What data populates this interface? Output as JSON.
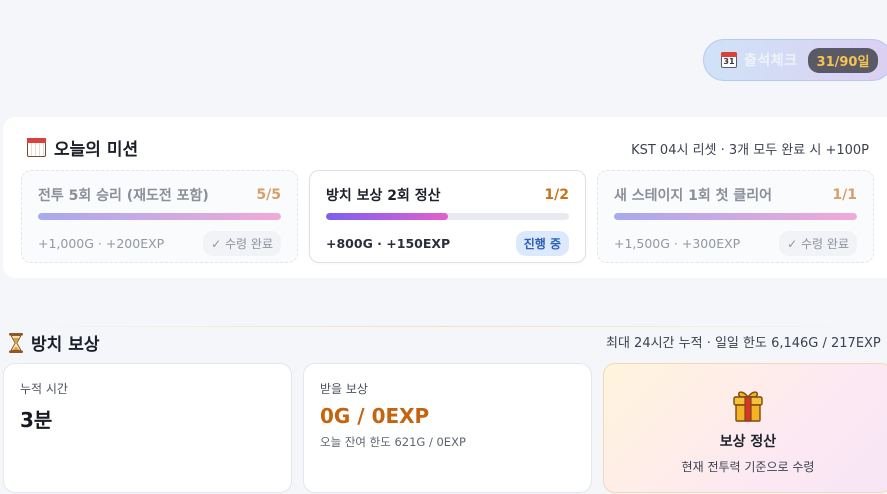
{
  "attendance": {
    "label": "출석체크",
    "count": "31/90일",
    "icon": "calendar-icon",
    "icon_text": "31"
  },
  "missions": {
    "title": "오늘의 미션",
    "meta": "KST 04시 리셋 · 3개 모두 완료 시 +100P",
    "items": [
      {
        "name": "전투 5회 승리 (재도전 포함)",
        "progress": "5/5",
        "fraction": 1.0,
        "reward": "+1,000G · +200EXP",
        "status": "✓ 수령 완료",
        "state": "done"
      },
      {
        "name": "방치 보상 2회 정산",
        "progress": "1/2",
        "fraction": 0.5,
        "reward": "+800G · +150EXP",
        "status": "진행 중",
        "state": "active"
      },
      {
        "name": "새 스테이지 1회 첫 클리어",
        "progress": "1/1",
        "fraction": 1.0,
        "reward": "+1,500G · +300EXP",
        "status": "✓ 수령 완료",
        "state": "done"
      }
    ]
  },
  "idle": {
    "title": "방치 보상",
    "meta": "최대 24시간 누적 · 일일 한도 6,146G / 217EXP",
    "accum_label": "누적 시간",
    "accum_value": "3분",
    "reward_label": "받을 보상",
    "reward_value": "0G / 0EXP",
    "reward_sub": "오늘 잔여 한도 621G / 0EXP",
    "claim_title": "보상 정산",
    "claim_sub": "현재 전투력 기준으로 수령"
  },
  "colors": {
    "accent_orange": "#c4640f",
    "progress_grad_start": "#7c5ff0",
    "progress_grad_end": "#e25fcf"
  }
}
